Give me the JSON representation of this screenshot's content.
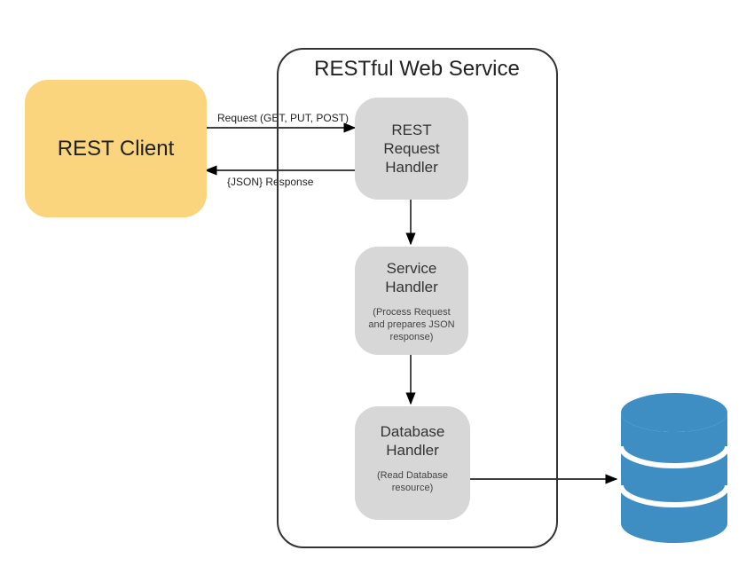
{
  "diagram": {
    "client_label": "REST Client",
    "container_title": "RESTful Web Service",
    "request_handler": {
      "title_line1": "REST",
      "title_line2": "Request",
      "title_line3": "Handler"
    },
    "service_handler": {
      "title_line1": "Service",
      "title_line2": "Handler",
      "subtitle": "(Process Request and prepares JSON response)"
    },
    "database_handler": {
      "title_line1": "Database",
      "title_line2": "Handler",
      "subtitle": "(Read Database resource)"
    },
    "edge_request_label": "Request (GET, PUT, POST)",
    "edge_response_label": "{JSON} Response",
    "colors": {
      "client_fill": "#fad57d",
      "handler_fill": "#d7d7d7",
      "db_fill": "#3e8ec4",
      "stroke": "#000000"
    }
  }
}
